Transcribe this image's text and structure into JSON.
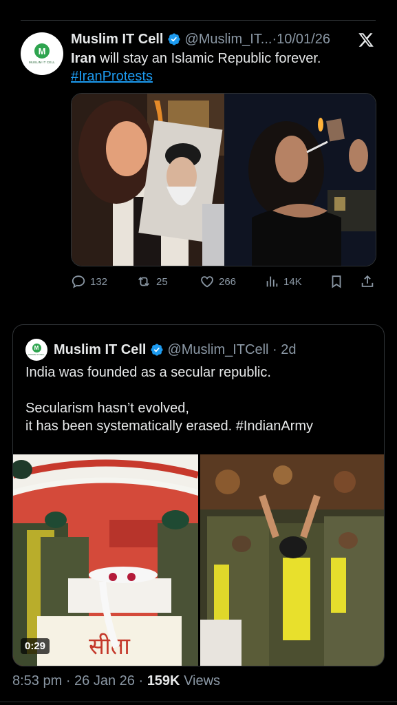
{
  "tweet": {
    "author_name": "Muslim IT Cell",
    "avatar_letter": "M",
    "avatar_caption": "MUSLIM IT CELL",
    "handle": "@Muslim_IT...",
    "date": "10/01/26",
    "text_bold": "Iran",
    "text_rest": " will stay an Islamic Republic forever.",
    "hashtag": "#IranProtests",
    "stats": {
      "replies": "132",
      "reposts": "25",
      "likes": "266",
      "views": "14K"
    }
  },
  "quote": {
    "author_name": "Muslim IT Cell",
    "avatar_letter": "M",
    "avatar_caption": "MUSLIM IT CELL",
    "handle": "@Muslim_ITCell",
    "age": "2d",
    "line1": "India was founded as a secular republic.",
    "line2": "Secularism hasn’t evolved,",
    "line3": "it has been systematically erased. #IndianArmy",
    "video_duration": "0:29"
  },
  "footer": {
    "time": "8:53 pm",
    "date": "26 Jan 26",
    "views_count": "159K",
    "views_label": "Views"
  },
  "colors": {
    "background": "#000000",
    "text": "#e7e9ea",
    "muted": "#8b98a5",
    "link": "#1d9bf0",
    "verified": "#1d9bf0",
    "border": "#2f3336"
  }
}
